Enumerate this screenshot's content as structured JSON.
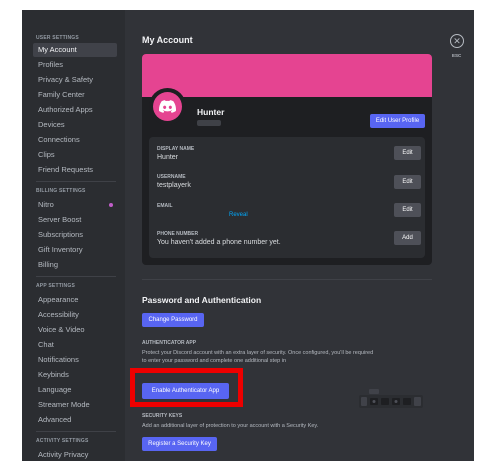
{
  "sidebar": {
    "user_settings_heading": "USER SETTINGS",
    "user_items": [
      "My Account",
      "Profiles",
      "Privacy & Safety",
      "Family Center",
      "Authorized Apps",
      "Devices",
      "Connections",
      "Clips",
      "Friend Requests"
    ],
    "billing_heading": "BILLING SETTINGS",
    "billing_items": [
      "Nitro",
      "Server Boost",
      "Subscriptions",
      "Gift Inventory",
      "Billing"
    ],
    "app_heading": "APP SETTINGS",
    "app_items": [
      "Appearance",
      "Accessibility",
      "Voice & Video",
      "Chat",
      "Notifications",
      "Keybinds",
      "Language",
      "Streamer Mode",
      "Advanced"
    ],
    "activity_heading": "ACTIVITY SETTINGS",
    "activity_items": [
      "Activity Privacy"
    ]
  },
  "main": {
    "title": "My Account",
    "close_glyph": "✕",
    "esc_label": "ESC",
    "profile": {
      "name": "Hunter",
      "edit_profile_label": "Edit User Profile",
      "banner_color": "#e54491"
    },
    "fields": {
      "display_name_label": "DISPLAY NAME",
      "display_name_value": "Hunter",
      "username_label": "USERNAME",
      "username_value": "testplayerk",
      "email_label": "EMAIL",
      "email_reveal": "Reveal",
      "phone_label": "PHONE NUMBER",
      "phone_value": "You haven't added a phone number yet.",
      "edit_label": "Edit",
      "add_label": "Add"
    },
    "security": {
      "title": "Password and Authentication",
      "change_password_label": "Change Password",
      "auth_app_heading": "AUTHENTICATOR APP",
      "auth_app_desc": "Protect your Discord account with an extra layer of security. Once configured, you'll be required to enter your password and complete one additional step in",
      "enable_auth_label": "Enable Authenticator App",
      "security_keys_heading": "SECURITY KEYS",
      "security_keys_desc": "Add an additional layer of protection to your account with a Security Key.",
      "register_key_label": "Register a Security Key"
    }
  },
  "colors": {
    "accent": "#5865f2",
    "highlight": "#ee0000",
    "nitro": "#c15ec9",
    "link": "#00a8fc"
  }
}
